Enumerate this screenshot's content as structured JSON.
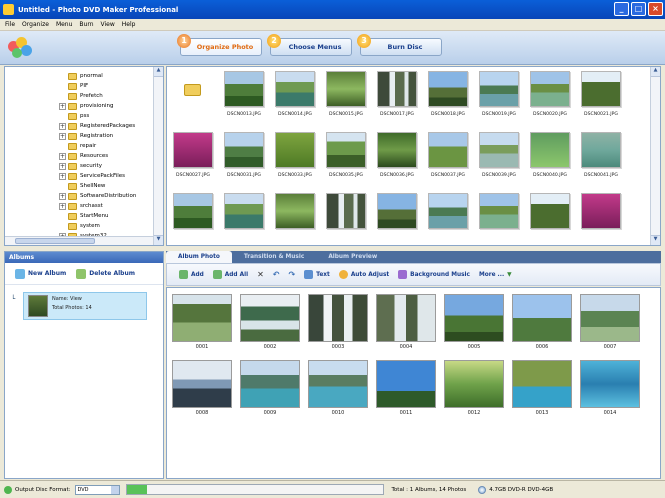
{
  "window": {
    "title": "Untitled - Photo DVD Maker Professional",
    "buttons": [
      "_",
      "□",
      "×"
    ]
  },
  "menu": [
    "File",
    "Organize",
    "Menu",
    "Burn",
    "View",
    "Help"
  ],
  "steps": [
    {
      "num": "1",
      "label": "Organize Photo"
    },
    {
      "num": "2",
      "label": "Choose Menus"
    },
    {
      "num": "3",
      "label": "Burn Disc"
    }
  ],
  "tree": [
    {
      "label": "pnormal",
      "plus": false
    },
    {
      "label": "PIF",
      "plus": false
    },
    {
      "label": "Prefetch",
      "plus": false
    },
    {
      "label": "provisioning",
      "plus": true
    },
    {
      "label": "pss",
      "plus": false
    },
    {
      "label": "RegisteredPackages",
      "plus": true
    },
    {
      "label": "Registration",
      "plus": true
    },
    {
      "label": "repair",
      "plus": false
    },
    {
      "label": "Resources",
      "plus": true
    },
    {
      "label": "security",
      "plus": true
    },
    {
      "label": "ServicePackFiles",
      "plus": true
    },
    {
      "label": "ShellNew",
      "plus": false
    },
    {
      "label": "SoftwareDistribution",
      "plus": true
    },
    {
      "label": "srchasst",
      "plus": true
    },
    {
      "label": "StartMenu",
      "plus": false
    },
    {
      "label": "system",
      "plus": false
    },
    {
      "label": "system32",
      "plus": true
    }
  ],
  "files": [
    {
      "name": ""
    },
    {
      "name": "DSCN0013.JPG"
    },
    {
      "name": "DSCN0014.JPG"
    },
    {
      "name": "DSCN0015.JPG"
    },
    {
      "name": "DSCN0017.JPG"
    },
    {
      "name": "DSCN0018.JPG"
    },
    {
      "name": "DSCN0019.JPG"
    },
    {
      "name": "DSCN0020.JPG"
    },
    {
      "name": "DSCN0021.JPG"
    },
    {
      "name": "DSCN0027.JPG"
    },
    {
      "name": "DSCN0031.JPG"
    },
    {
      "name": "DSCN0033.JPG"
    },
    {
      "name": "DSCN0035.JPG"
    },
    {
      "name": "DSCN0036.JPG"
    },
    {
      "name": "DSCN0037.JPG"
    },
    {
      "name": "DSCN0039.JPG"
    },
    {
      "name": "DSCN0040.JPG"
    },
    {
      "name": "DSCN0041.JPG"
    },
    {
      "name": ""
    },
    {
      "name": ""
    },
    {
      "name": ""
    },
    {
      "name": ""
    },
    {
      "name": ""
    },
    {
      "name": ""
    },
    {
      "name": ""
    },
    {
      "name": ""
    },
    {
      "name": ""
    }
  ],
  "albums_panel": {
    "header": "Albums",
    "new_album": "New Album",
    "delete_album": "Delete Album",
    "album_name": "Name: View",
    "album_total": "Total Photos: 14"
  },
  "tabs": [
    "Album Photo",
    "Transition & Music",
    "Album Preview"
  ],
  "album_tools": [
    "Add",
    "Add All",
    "",
    "",
    "",
    "Text",
    "Auto Adjust",
    "Background Music",
    "More ..."
  ],
  "album_photos": [
    "0001",
    "0002",
    "0003",
    "0004",
    "0005",
    "0006",
    "0007",
    "0008",
    "0009",
    "0010",
    "0011",
    "0012",
    "0013",
    "0014"
  ],
  "status": {
    "output_label": "Output Disc Format:",
    "output_value": "DVD",
    "capacity_fraction": 0.08,
    "total": "Total : 1 Albums, 14 Photos",
    "disc": "4.7GB DVD-R   DVD-4GB"
  },
  "colors": {
    "titlebar": "#0845b8",
    "panel_header": "#3a68b8",
    "album_selected": "#cbe9f9",
    "capacity_fill": "#59c259"
  }
}
